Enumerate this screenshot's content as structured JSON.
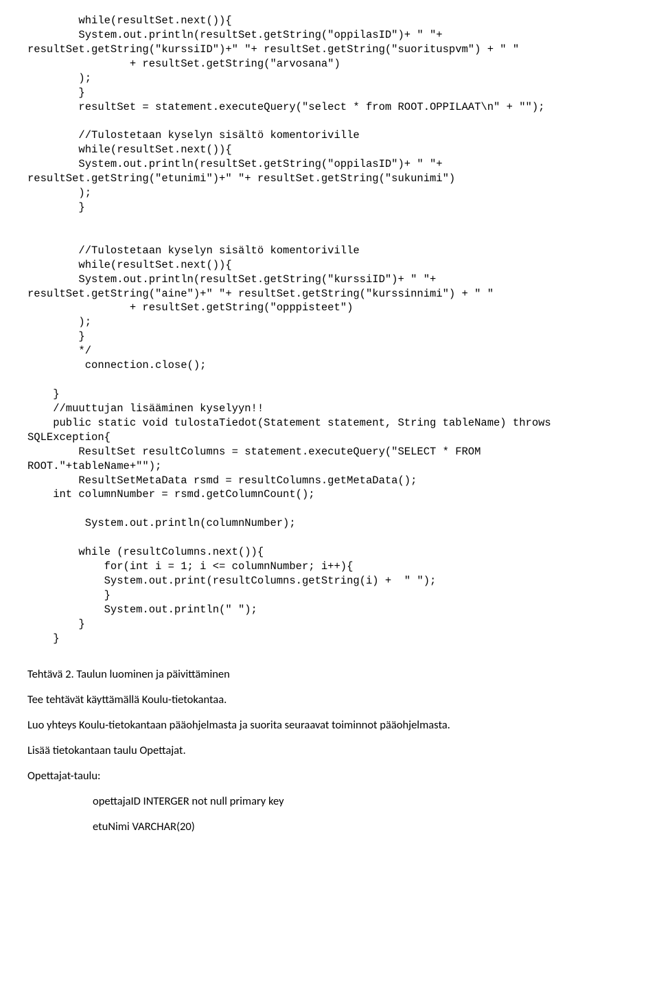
{
  "code": "        while(resultSet.next()){\n        System.out.println(resultSet.getString(\"oppilasID\")+ \" \"+\nresultSet.getString(\"kurssiID\")+\" \"+ resultSet.getString(\"suorituspvm\") + \" \"\n                + resultSet.getString(\"arvosana\")\n        );\n        }\n        resultSet = statement.executeQuery(\"select * from ROOT.OPPILAAT\\n\" + \"\");\n\n        //Tulostetaan kyselyn sisältö komentoriville\n        while(resultSet.next()){\n        System.out.println(resultSet.getString(\"oppilasID\")+ \" \"+\nresultSet.getString(\"etunimi\")+\" \"+ resultSet.getString(\"sukunimi\")\n        );\n        }\n\n\n        //Tulostetaan kyselyn sisältö komentoriville\n        while(resultSet.next()){\n        System.out.println(resultSet.getString(\"kurssiID\")+ \" \"+\nresultSet.getString(\"aine\")+\" \"+ resultSet.getString(\"kurssinnimi\") + \" \"\n                + resultSet.getString(\"opppisteet\")\n        );\n        }\n        */\n         connection.close();\n\n    }\n    //muuttujan lisääminen kyselyyn!!\n    public static void tulostaTiedot(Statement statement, String tableName) throws\nSQLException{\n        ResultSet resultColumns = statement.executeQuery(\"SELECT * FROM\nROOT.\"+tableName+\"\");\n        ResultSetMetaData rsmd = resultColumns.getMetaData();\n    int columnNumber = rsmd.getColumnCount();\n\n         System.out.println(columnNumber);\n\n        while (resultColumns.next()){\n            for(int i = 1; i <= columnNumber; i++){\n            System.out.print(resultColumns.getString(i) +  \" \");\n            }\n            System.out.println(\" \");\n        }\n    }",
  "prose": {
    "heading": "Tehtävä 2. Taulun luominen ja päivittäminen",
    "p1": "Tee tehtävät käyttämällä Koulu-tietokantaa.",
    "p2": "Luo yhteys Koulu-tietokantaan pääohjelmasta ja suorita seuraavat toiminnot pääohjelmasta.",
    "p3": "Lisää tietokantaan taulu Opettajat.",
    "p4": "Opettajat-taulu:",
    "indent1": "opettajaID INTERGER not null primary key",
    "indent2": "etuNimi VARCHAR(20)"
  }
}
